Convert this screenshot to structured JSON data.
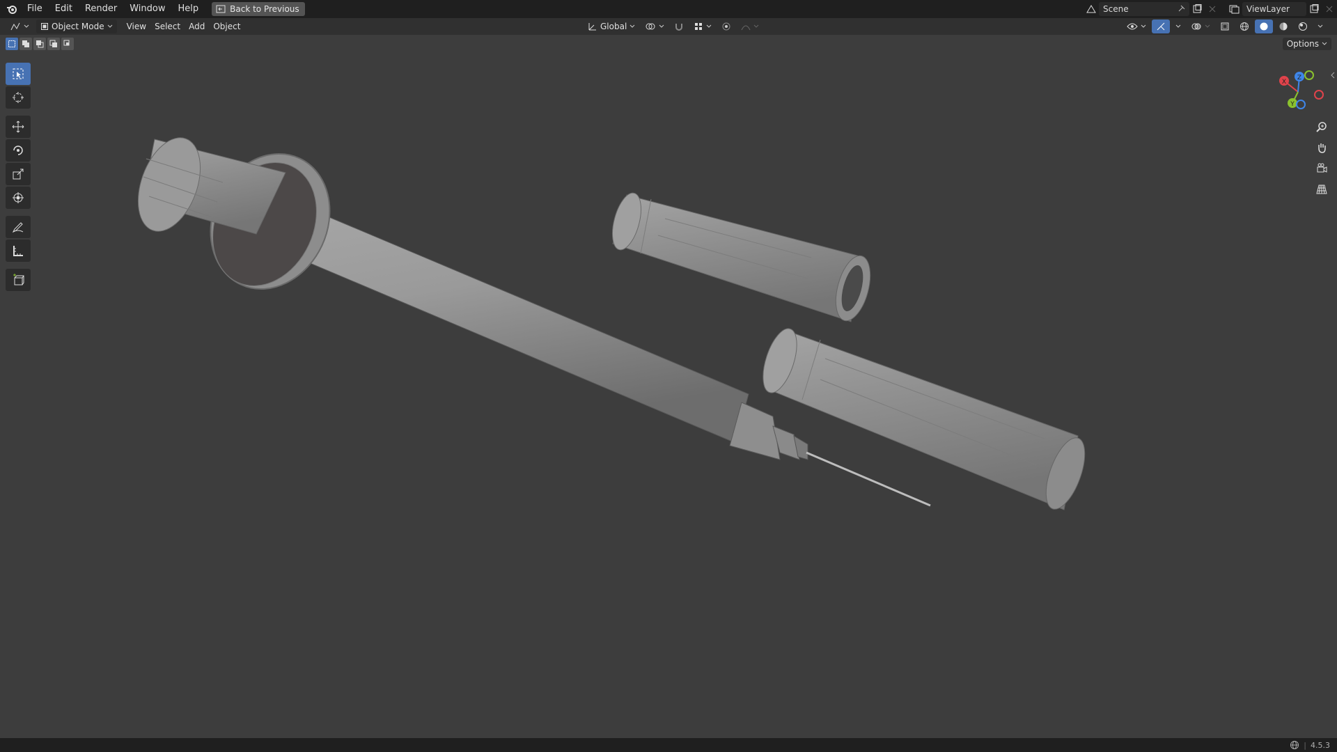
{
  "topbar": {
    "menus": [
      "File",
      "Edit",
      "Render",
      "Window",
      "Help"
    ],
    "back_button": "Back to Previous",
    "scene": "Scene",
    "view_layer": "ViewLayer"
  },
  "header": {
    "mode": "Object Mode",
    "menus": [
      "View",
      "Select",
      "Add",
      "Object"
    ],
    "orientation": "Global",
    "options": "Options"
  },
  "toolbar": {
    "tools": [
      "select-box",
      "cursor",
      "move",
      "rotate",
      "scale",
      "transform",
      "annotate",
      "measure",
      "add-cube"
    ],
    "active": "select-box"
  },
  "gizmo": {
    "x_label": "X",
    "y_label": "Y",
    "z_label": "Z"
  },
  "statusbar": {
    "version": "4.5.3"
  },
  "colors": {
    "accent": "#4772b3",
    "viewport_bg": "#3d3d3d",
    "axis_x": "#e0434b",
    "axis_y": "#8bc22e",
    "axis_z": "#3f86e8"
  }
}
